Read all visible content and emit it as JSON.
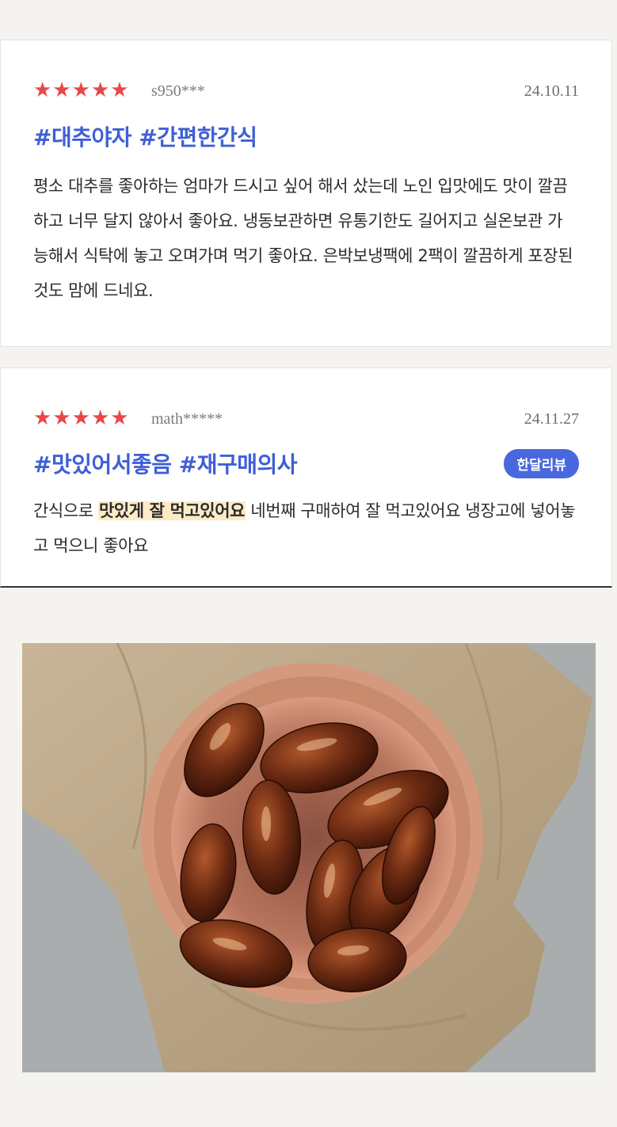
{
  "reviews": [
    {
      "rating": 5,
      "user": "s950***",
      "date": "24.10.11",
      "tags": "#대추야자 #간편한간식",
      "body": "평소 대추를 좋아하는 엄마가 드시고 싶어 해서 샀는데 노인 입맛에도 맛이 깔끔하고 너무 달지 않아서 좋아요. 냉동보관하면 유통기한도 길어지고 실온보관 가능해서 식탁에 놓고 오며가며 먹기 좋아요. 은박보냉팩에 2팩이 깔끔하게 포장된 것도 맘에 드네요."
    },
    {
      "rating": 5,
      "user": "math*****",
      "date": "24.11.27",
      "tags": "#맛있어서좋음 #재구매의사",
      "badge": "한달리뷰",
      "body_pre": "간식으로 ",
      "body_highlight": "맛있게 잘 먹고있어요",
      "body_post": " 네번째 구매하여 잘 먹고있어요 냉장고에 넣어놓고 먹으니 좋아요"
    }
  ],
  "colors": {
    "star": "#e8484a",
    "tag": "#3f5fd6",
    "badge_bg": "#4a68dd",
    "highlight": "#fdebc6"
  },
  "icons": {
    "star": "star-icon"
  }
}
